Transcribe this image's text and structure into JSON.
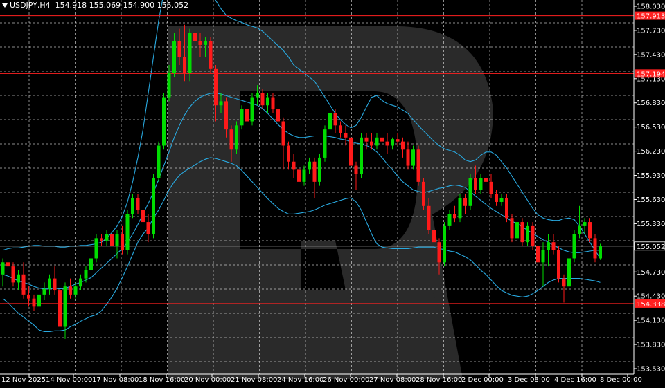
{
  "header": {
    "symbol": "USDJPY,H4",
    "ohlc": "154.918 155.069 154.900 155.052"
  },
  "colors": {
    "background": "#000000",
    "bull": "#00dd00",
    "bear": "#ff1a1a",
    "bands": "#29a9e0",
    "level_line": "#ff2020",
    "grid": "#ffffff",
    "text": "#ffffff"
  },
  "watermark": "RoboForex logo (large faded letter R)",
  "chart_data": {
    "type": "candlestick",
    "instrument": "USDJPY",
    "timeframe": "H4",
    "grid": true,
    "ylim": [
      153.53,
      158.03
    ],
    "y_ticks": [
      "158.030",
      "157.730",
      "157.430",
      "157.130",
      "156.830",
      "156.530",
      "156.230",
      "155.930",
      "155.630",
      "155.330",
      "155.030",
      "154.730",
      "154.430",
      "154.130",
      "153.830",
      "153.530"
    ],
    "x_ticks": [
      "12 Nov 2025",
      "14 Nov 00:00",
      "17 Nov 08:00",
      "18 Nov 16:00",
      "20 Nov 00:00",
      "21 Nov 08:00",
      "24 Nov 16:00",
      "26 Nov 00:00",
      "27 Nov 08:00",
      "28 Nov 16:00",
      "2 Dec 00:00",
      "3 Dec 08:00",
      "4 Dec 16:00",
      "8 Dec 00:00"
    ],
    "levels": [
      {
        "label": "157.913",
        "value": 157.913
      },
      {
        "label": "157.194",
        "value": 157.194
      },
      {
        "label": "154.338",
        "value": 154.338
      }
    ],
    "current_price": "155.052",
    "candles": [
      [
        154.7,
        154.9,
        154.55,
        154.85
      ],
      [
        154.85,
        154.95,
        154.7,
        154.8
      ],
      [
        154.8,
        154.85,
        154.55,
        154.6
      ],
      [
        154.6,
        154.75,
        154.5,
        154.7
      ],
      [
        154.7,
        154.85,
        154.4,
        154.45
      ],
      [
        154.45,
        154.55,
        154.3,
        154.4
      ],
      [
        154.4,
        154.45,
        154.25,
        154.3
      ],
      [
        154.3,
        154.5,
        154.25,
        154.45
      ],
      [
        154.45,
        154.6,
        154.38,
        154.52
      ],
      [
        154.52,
        154.7,
        154.45,
        154.65
      ],
      [
        154.65,
        154.8,
        154.45,
        154.5
      ],
      [
        154.5,
        154.7,
        153.6,
        154.05
      ],
      [
        154.05,
        154.6,
        153.9,
        154.55
      ],
      [
        154.55,
        154.65,
        154.4,
        154.45
      ],
      [
        154.45,
        154.6,
        154.4,
        154.55
      ],
      [
        154.55,
        154.7,
        154.5,
        154.65
      ],
      [
        154.65,
        154.8,
        154.6,
        154.75
      ],
      [
        154.75,
        154.95,
        154.7,
        154.9
      ],
      [
        154.9,
        155.2,
        154.85,
        155.15
      ],
      [
        155.15,
        155.2,
        155.05,
        155.12
      ],
      [
        155.12,
        155.25,
        155.05,
        155.2
      ],
      [
        155.2,
        155.25,
        155.0,
        155.05
      ],
      [
        155.05,
        155.25,
        154.9,
        155.2
      ],
      [
        155.2,
        155.3,
        154.95,
        155.0
      ],
      [
        155.0,
        155.5,
        154.95,
        155.45
      ],
      [
        155.45,
        155.7,
        155.4,
        155.65
      ],
      [
        155.65,
        155.7,
        155.45,
        155.5
      ],
      [
        155.5,
        155.55,
        155.25,
        155.35
      ],
      [
        155.35,
        155.45,
        155.1,
        155.2
      ],
      [
        155.2,
        155.95,
        155.15,
        155.9
      ],
      [
        155.9,
        156.35,
        155.85,
        156.3
      ],
      [
        156.3,
        156.95,
        156.25,
        156.9
      ],
      [
        156.9,
        157.3,
        156.85,
        157.2
      ],
      [
        157.2,
        157.7,
        157.15,
        157.6
      ],
      [
        157.6,
        157.75,
        157.3,
        157.4
      ],
      [
        157.4,
        157.8,
        157.1,
        157.2
      ],
      [
        157.2,
        157.75,
        157.1,
        157.7
      ],
      [
        157.7,
        157.75,
        157.55,
        157.6
      ],
      [
        157.6,
        157.7,
        157.4,
        157.55
      ],
      [
        157.55,
        157.65,
        157.4,
        157.6
      ],
      [
        157.6,
        157.65,
        157.2,
        157.25
      ],
      [
        157.25,
        157.3,
        156.6,
        156.8
      ],
      [
        156.8,
        156.95,
        156.7,
        156.85
      ],
      [
        156.85,
        156.9,
        156.4,
        156.5
      ],
      [
        156.5,
        156.55,
        156.1,
        156.25
      ],
      [
        156.25,
        156.6,
        156.2,
        156.55
      ],
      [
        156.55,
        156.8,
        156.5,
        156.75
      ],
      [
        156.75,
        156.8,
        156.55,
        156.6
      ],
      [
        156.6,
        156.95,
        156.55,
        156.9
      ],
      [
        156.9,
        157.05,
        156.8,
        156.95
      ],
      [
        156.95,
        157.0,
        156.75,
        156.8
      ],
      [
        156.8,
        156.95,
        156.7,
        156.9
      ],
      [
        156.9,
        156.95,
        156.7,
        156.75
      ],
      [
        156.75,
        156.85,
        156.5,
        156.6
      ],
      [
        156.6,
        156.65,
        156.0,
        156.3
      ],
      [
        156.3,
        156.35,
        156.0,
        156.1
      ],
      [
        156.1,
        156.2,
        155.9,
        156.0
      ],
      [
        156.0,
        156.1,
        155.8,
        155.85
      ],
      [
        155.85,
        156.05,
        155.8,
        156.0
      ],
      [
        156.0,
        156.15,
        155.95,
        156.1
      ],
      [
        156.1,
        156.15,
        155.65,
        155.85
      ],
      [
        155.85,
        156.2,
        155.8,
        156.15
      ],
      [
        156.15,
        156.55,
        156.1,
        156.5
      ],
      [
        156.5,
        156.75,
        156.4,
        156.7
      ],
      [
        156.7,
        156.75,
        156.45,
        156.55
      ],
      [
        156.55,
        156.6,
        156.4,
        156.45
      ],
      [
        156.45,
        156.55,
        156.3,
        156.4
      ],
      [
        156.4,
        156.45,
        156.0,
        156.05
      ],
      [
        156.05,
        156.1,
        155.75,
        155.95
      ],
      [
        155.95,
        156.45,
        155.9,
        156.4
      ],
      [
        156.4,
        156.45,
        156.25,
        156.35
      ],
      [
        156.35,
        156.45,
        156.25,
        156.3
      ],
      [
        156.3,
        156.45,
        156.25,
        156.4
      ],
      [
        156.4,
        156.65,
        156.3,
        156.35
      ],
      [
        156.35,
        156.45,
        156.2,
        156.3
      ],
      [
        156.3,
        156.4,
        156.25,
        156.38
      ],
      [
        156.38,
        156.45,
        156.3,
        156.35
      ],
      [
        156.35,
        156.4,
        156.15,
        156.25
      ],
      [
        156.25,
        156.35,
        156.0,
        156.05
      ],
      [
        156.05,
        156.3,
        156.0,
        156.25
      ],
      [
        156.25,
        156.3,
        155.8,
        155.85
      ],
      [
        155.85,
        155.9,
        155.5,
        155.55
      ],
      [
        155.55,
        155.65,
        155.2,
        155.25
      ],
      [
        155.25,
        155.35,
        155.0,
        155.1
      ],
      [
        155.1,
        155.15,
        154.7,
        154.85
      ],
      [
        154.85,
        155.35,
        154.8,
        155.3
      ],
      [
        155.3,
        155.5,
        155.25,
        155.45
      ],
      [
        155.45,
        155.55,
        155.35,
        155.4
      ],
      [
        155.4,
        155.7,
        155.35,
        155.65
      ],
      [
        155.65,
        155.7,
        155.45,
        155.55
      ],
      [
        155.55,
        155.95,
        155.5,
        155.9
      ],
      [
        155.9,
        156.05,
        155.7,
        155.75
      ],
      [
        155.75,
        155.95,
        155.7,
        155.9
      ],
      [
        155.9,
        156.15,
        155.8,
        155.85
      ],
      [
        155.85,
        155.95,
        155.65,
        155.7
      ],
      [
        155.7,
        155.75,
        155.55,
        155.6
      ],
      [
        155.6,
        155.7,
        155.55,
        155.65
      ],
      [
        155.65,
        155.7,
        155.35,
        155.4
      ],
      [
        155.4,
        155.45,
        155.1,
        155.15
      ],
      [
        155.15,
        155.4,
        155.0,
        155.35
      ],
      [
        155.35,
        155.4,
        155.05,
        155.1
      ],
      [
        155.1,
        155.35,
        155.05,
        155.3
      ],
      [
        155.3,
        155.35,
        155.0,
        155.05
      ],
      [
        155.05,
        155.15,
        154.75,
        154.85
      ],
      [
        154.85,
        155.1,
        154.55,
        155.0
      ],
      [
        155.0,
        155.2,
        154.8,
        155.1
      ],
      [
        155.1,
        155.2,
        154.95,
        155.0
      ],
      [
        155.0,
        155.05,
        154.6,
        154.65
      ],
      [
        154.65,
        154.7,
        154.35,
        154.55
      ],
      [
        154.55,
        154.95,
        154.5,
        154.9
      ],
      [
        154.9,
        155.25,
        154.85,
        155.2
      ],
      [
        155.2,
        155.55,
        155.15,
        155.3
      ],
      [
        155.3,
        155.4,
        155.2,
        155.35
      ],
      [
        155.35,
        155.4,
        155.1,
        155.15
      ],
      [
        155.15,
        155.2,
        154.85,
        154.9
      ],
      [
        154.9,
        155.08,
        154.88,
        155.05
      ]
    ],
    "bollinger": {
      "upper": [
        155.0,
        155.02,
        155.03,
        155.03,
        155.04,
        155.05,
        155.06,
        155.06,
        155.05,
        155.05,
        155.05,
        155.04,
        155.04,
        155.05,
        155.05,
        155.06,
        155.06,
        155.07,
        155.08,
        155.1,
        155.15,
        155.22,
        155.3,
        155.42,
        155.6,
        155.85,
        156.15,
        156.5,
        156.95,
        157.4,
        157.85,
        158.2,
        158.45,
        158.6,
        158.7,
        158.72,
        158.7,
        158.6,
        158.45,
        158.3,
        158.2,
        158.1,
        158.0,
        157.92,
        157.88,
        157.85,
        157.83,
        157.8,
        157.78,
        157.76,
        157.72,
        157.66,
        157.6,
        157.54,
        157.48,
        157.4,
        157.3,
        157.25,
        157.2,
        157.15,
        157.1,
        157.0,
        156.9,
        156.8,
        156.7,
        156.62,
        156.56,
        156.52,
        156.55,
        156.65,
        156.78,
        156.9,
        156.92,
        156.86,
        156.82,
        156.8,
        156.78,
        156.74,
        156.7,
        156.62,
        156.55,
        156.48,
        156.42,
        156.35,
        156.3,
        156.26,
        156.24,
        156.22,
        156.18,
        156.12,
        156.1,
        156.12,
        156.18,
        156.22,
        156.22,
        156.18,
        156.1,
        156.02,
        155.92,
        155.82,
        155.72,
        155.62,
        155.52,
        155.44,
        155.4,
        155.38,
        155.37,
        155.37,
        155.39,
        155.4,
        155.38,
        155.3,
        155.2,
        155.1,
        155.0,
        154.9
      ],
      "middle": [
        154.7,
        154.68,
        154.65,
        154.62,
        154.6,
        154.58,
        154.55,
        154.53,
        154.52,
        154.52,
        154.53,
        154.52,
        154.53,
        154.55,
        154.58,
        154.6,
        154.63,
        154.66,
        154.72,
        154.78,
        154.84,
        154.9,
        154.96,
        155.02,
        155.1,
        155.2,
        155.32,
        155.45,
        155.58,
        155.72,
        155.88,
        156.05,
        156.22,
        156.4,
        156.55,
        156.68,
        156.78,
        156.85,
        156.9,
        156.93,
        156.95,
        156.95,
        156.94,
        156.92,
        156.9,
        156.88,
        156.86,
        156.84,
        156.82,
        156.8,
        156.76,
        156.7,
        156.63,
        156.56,
        156.5,
        156.45,
        156.42,
        156.4,
        156.4,
        156.41,
        156.42,
        156.42,
        156.42,
        156.41,
        156.4,
        156.38,
        156.37,
        156.35,
        156.33,
        156.32,
        156.3,
        156.27,
        156.22,
        156.15,
        156.07,
        156.0,
        155.92,
        155.85,
        155.8,
        155.75,
        155.73,
        155.72,
        155.73,
        155.75,
        155.77,
        155.78,
        155.8,
        155.81,
        155.8,
        155.78,
        155.73,
        155.67,
        155.62,
        155.57,
        155.52,
        155.48,
        155.44,
        155.4,
        155.36,
        155.33,
        155.29,
        155.25,
        155.21,
        155.17,
        155.13,
        155.1,
        155.06,
        155.03,
        155.0,
        154.98,
        154.97,
        154.97,
        154.98,
        154.99,
        155.0,
        155.0
      ],
      "lower": [
        154.4,
        154.35,
        154.28,
        154.22,
        154.17,
        154.12,
        154.07,
        154.01,
        153.99,
        153.99,
        154.0,
        154.0,
        154.01,
        154.05,
        154.08,
        154.12,
        154.15,
        154.18,
        154.2,
        154.25,
        154.33,
        154.42,
        154.53,
        154.66,
        154.8,
        154.95,
        155.1,
        155.2,
        155.28,
        155.4,
        155.5,
        155.62,
        155.75,
        155.85,
        155.93,
        155.98,
        156.02,
        156.06,
        156.1,
        156.13,
        156.15,
        156.14,
        156.12,
        156.1,
        156.08,
        156.05,
        155.99,
        155.92,
        155.85,
        155.78,
        155.71,
        155.64,
        155.58,
        155.52,
        155.48,
        155.45,
        155.45,
        155.46,
        155.47,
        155.48,
        155.5,
        155.53,
        155.56,
        155.58,
        155.6,
        155.62,
        155.64,
        155.65,
        155.6,
        155.5,
        155.35,
        155.2,
        155.08,
        155.04,
        155.03,
        155.02,
        155.02,
        155.02,
        155.02,
        155.03,
        155.04,
        155.04,
        155.04,
        155.04,
        155.02,
        155.01,
        154.99,
        154.98,
        154.95,
        154.92,
        154.88,
        154.82,
        154.75,
        154.7,
        154.63,
        154.56,
        154.5,
        154.47,
        154.44,
        154.43,
        154.42,
        154.43,
        154.46,
        154.5,
        154.55,
        154.6,
        154.63,
        154.65,
        154.65,
        154.65,
        154.65,
        154.65,
        154.64,
        154.63,
        154.62,
        154.6
      ]
    }
  }
}
